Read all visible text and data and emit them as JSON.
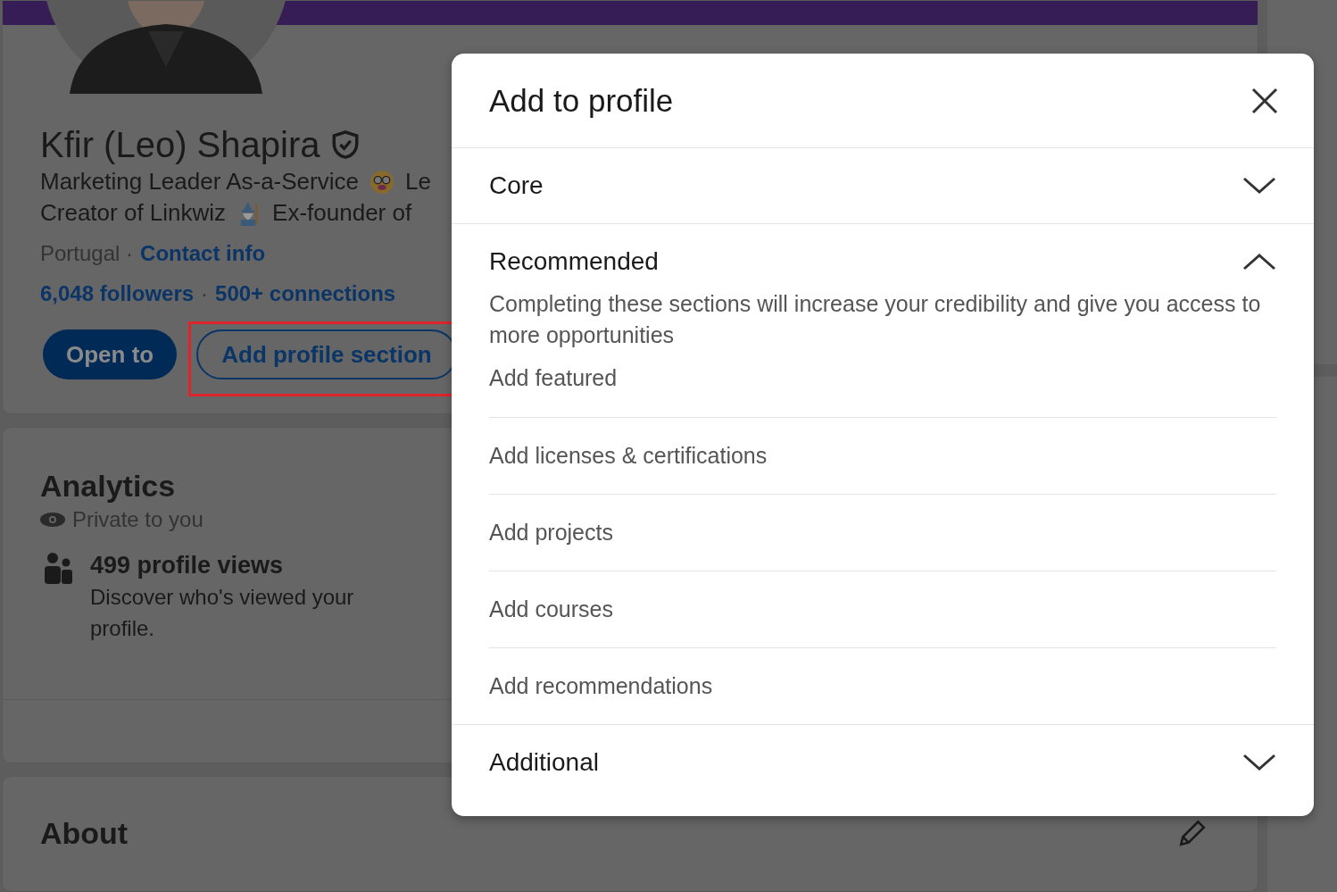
{
  "profile": {
    "name": "Kfir (Leo) Shapira",
    "verified": true,
    "headline": [
      {
        "before": "Marketing Leader As-a-Service",
        "kind": "nerd",
        "after": "Le"
      },
      {
        "before": "Creator of Linkwiz",
        "kind": "wizard",
        "after": "Ex-founder of"
      }
    ],
    "location": "Portugal",
    "location_separator": "·",
    "contact_link": "Contact info",
    "followers": "6,048 followers",
    "stats_separator": "·",
    "connections": "500+ connections",
    "buttons": [
      {
        "label": "Open to",
        "kind": "primary",
        "highlighted": false
      },
      {
        "label": "Add profile section",
        "kind": "outline",
        "highlighted": true
      }
    ]
  },
  "analytics": {
    "title": "Analytics",
    "privacy": "Private to you",
    "views_title": "499 profile views",
    "views_desc": "Discover who's viewed your profile."
  },
  "about": {
    "title": "About"
  },
  "modal": {
    "title": "Add to profile",
    "sections": [
      {
        "title": "Core",
        "expanded": false
      },
      {
        "title": "Recommended",
        "expanded": true,
        "description": "Completing these sections will increase your credibility and give you access to more opportunities",
        "items": [
          "Add featured",
          "Add licenses & certifications",
          "Add projects",
          "Add courses",
          "Add recommendations"
        ]
      },
      {
        "title": "Additional",
        "expanded": false
      }
    ]
  }
}
